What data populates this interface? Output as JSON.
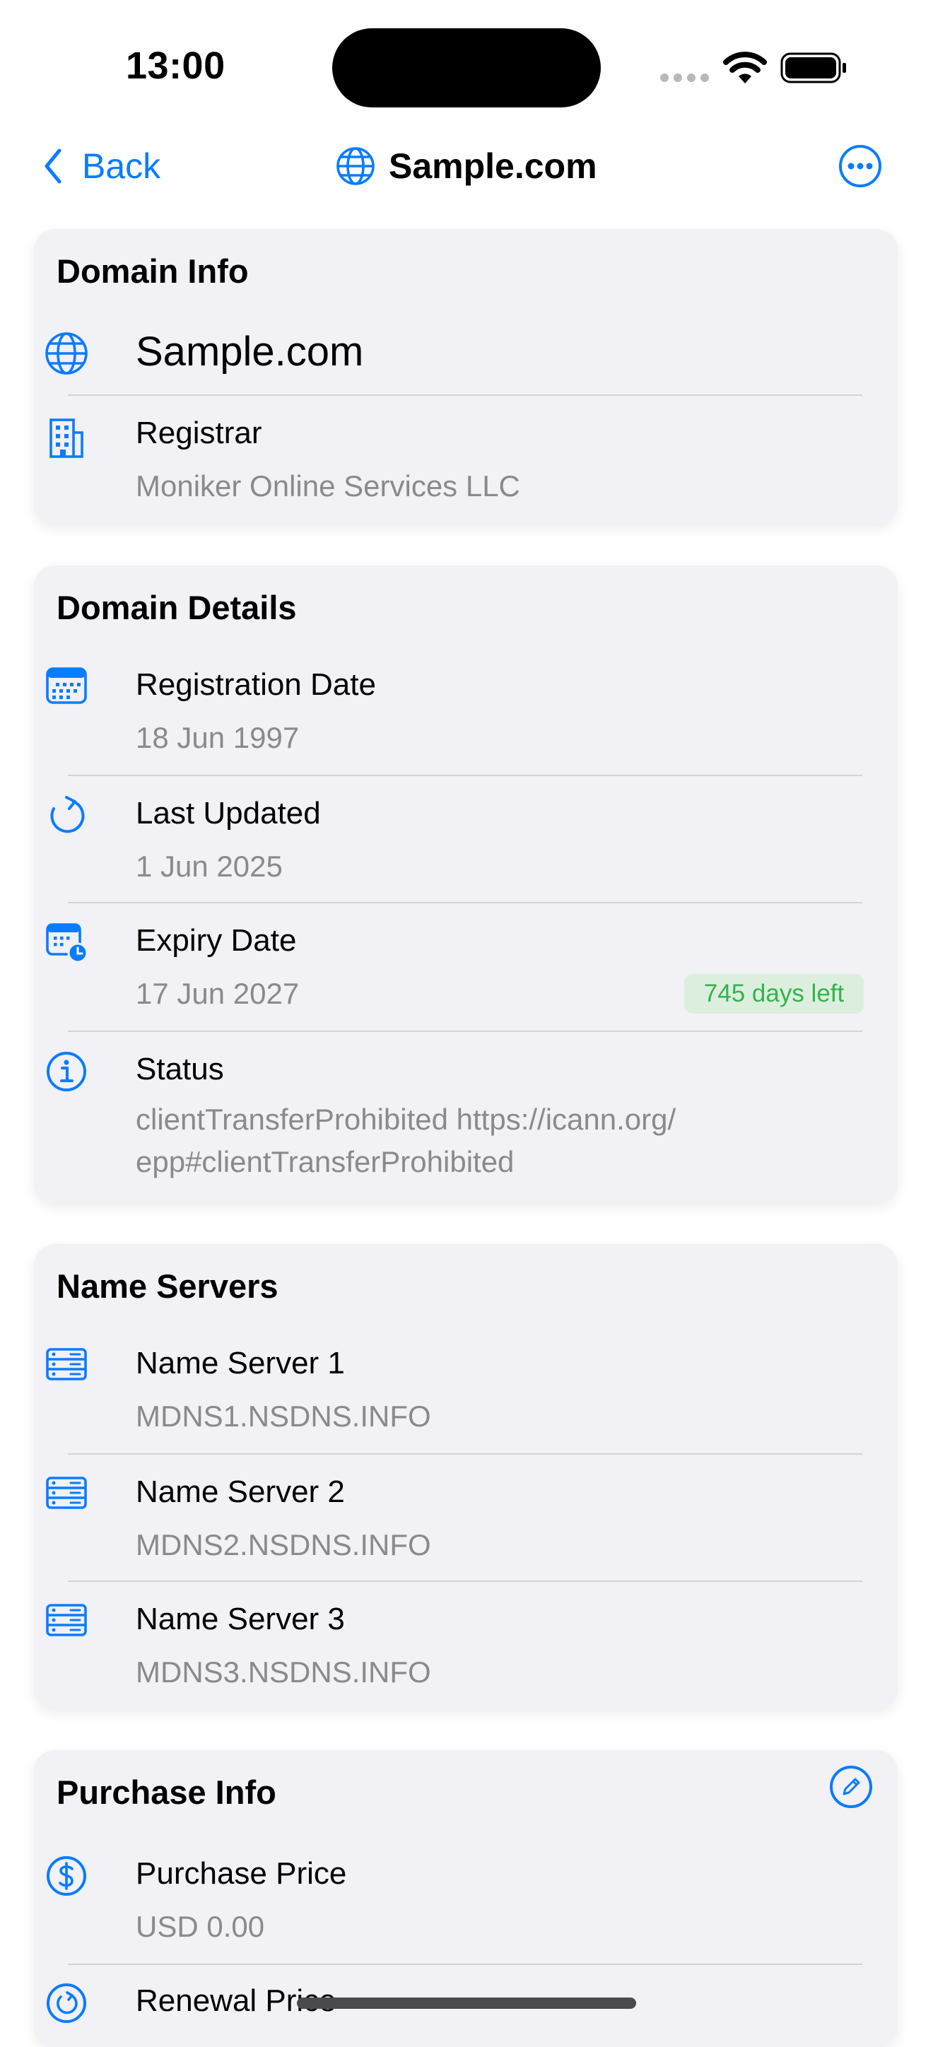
{
  "status_bar": {
    "time": "13:00"
  },
  "nav": {
    "back_label": "Back",
    "title": "Sample.com"
  },
  "domain_info": {
    "title": "Domain Info",
    "domain_name": "Sample.com",
    "registrar_label": "Registrar",
    "registrar_value": "Moniker Online Services LLC"
  },
  "domain_details": {
    "title": "Domain Details",
    "registration_label": "Registration Date",
    "registration_value": "18 Jun 1997",
    "updated_label": "Last Updated",
    "updated_value": "1 Jun 2025",
    "expiry_label": "Expiry Date",
    "expiry_value": "17 Jun 2027",
    "expiry_badge": "745 days left",
    "status_label": "Status",
    "status_value": "clientTransferProhibited https://icann.org/ epp#clientTransferProhibited"
  },
  "name_servers": {
    "title": "Name Servers",
    "items": [
      {
        "label": "Name Server 1",
        "value": "MDNS1.NSDNS.INFO"
      },
      {
        "label": "Name Server 2",
        "value": "MDNS2.NSDNS.INFO"
      },
      {
        "label": "Name Server 3",
        "value": "MDNS3.NSDNS.INFO"
      }
    ]
  },
  "purchase_info": {
    "title": "Purchase Info",
    "purchase_label": "Purchase Price",
    "purchase_value": "USD 0.00",
    "renewal_label": "Renewal Price"
  },
  "colors": {
    "accent": "#0a7cff",
    "card_background": "#f1f1f6",
    "secondary_text": "#8a8a8e",
    "badge_text": "#34b34d",
    "badge_background": "#dcefde"
  }
}
